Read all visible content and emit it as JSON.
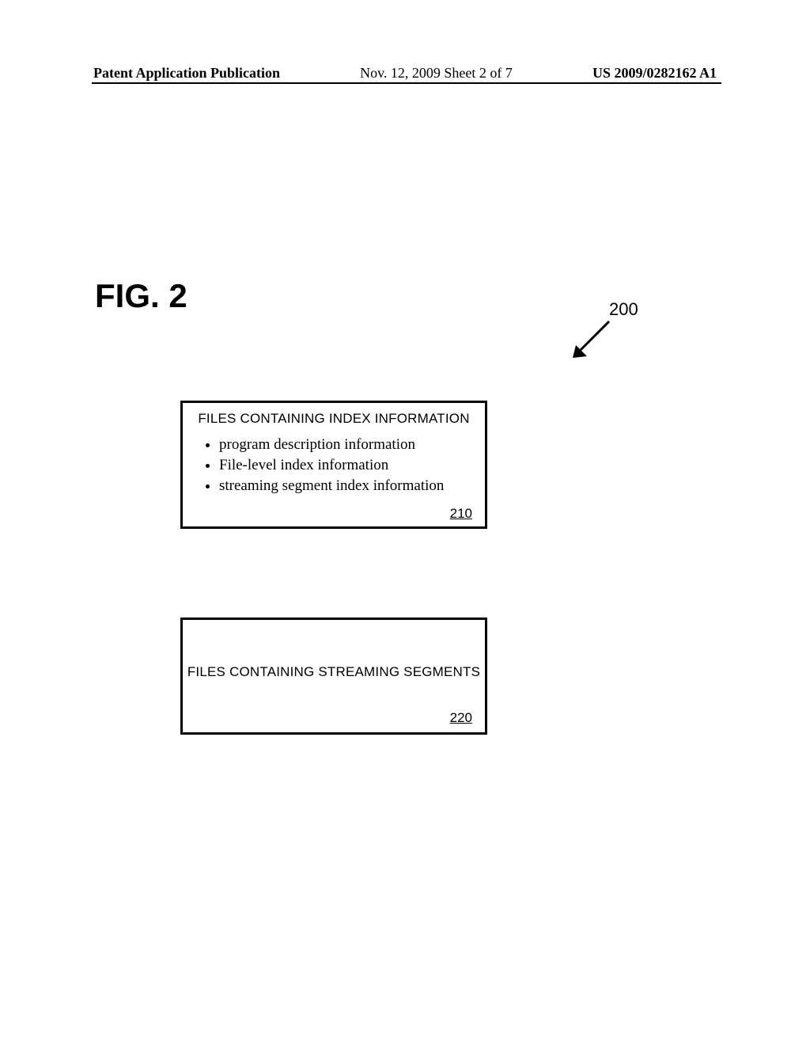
{
  "header": {
    "left": "Patent Application Publication",
    "center": "Nov. 12, 2009  Sheet 2 of 7",
    "right": "US 2009/0282162 A1"
  },
  "figure": {
    "label": "FIG. 2",
    "ref": "200"
  },
  "box210": {
    "title": "FILES CONTAINING INDEX INFORMATION",
    "items": [
      "program description information",
      "File-level index information",
      "streaming segment index information"
    ],
    "ref": "210"
  },
  "box220": {
    "title": "FILES CONTAINING STREAMING SEGMENTS",
    "ref": "220"
  }
}
